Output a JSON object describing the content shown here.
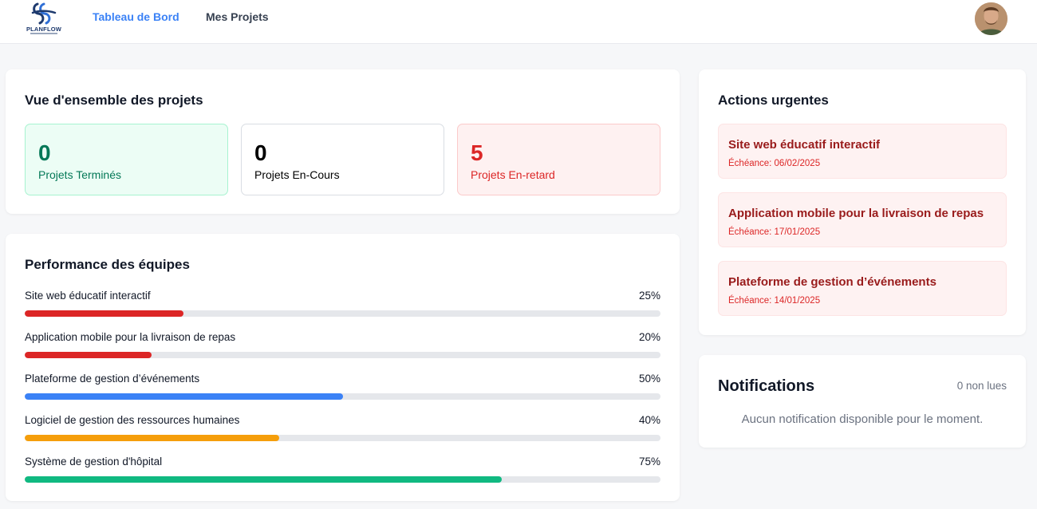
{
  "brand": {
    "name": "PLANFLOW",
    "accent_color": "#3b82f6"
  },
  "nav": {
    "links": [
      {
        "label": "Tableau de Bord",
        "active": true
      },
      {
        "label": "Mes Projets",
        "active": false
      }
    ],
    "avatar_icon": "user-avatar"
  },
  "overview": {
    "title": "Vue d'ensemble des projets",
    "stats": [
      {
        "value": "0",
        "label": "Projets Terminés",
        "color": "#047857"
      },
      {
        "value": "0",
        "label": "Projets En-Cours",
        "color": "#000000"
      },
      {
        "value": "5",
        "label": "Projets En-retard",
        "color": "#dc2626"
      }
    ]
  },
  "performance": {
    "title": "Performance des équipes",
    "items": [
      {
        "name": "Site web éducatif interactif",
        "percent_label": "25%",
        "value": 25,
        "color": "#dc2626"
      },
      {
        "name": "Application mobile pour la livraison de repas",
        "percent_label": "20%",
        "value": 20,
        "color": "#dc2626"
      },
      {
        "name": "Plateforme de gestion d’événements",
        "percent_label": "50%",
        "value": 50,
        "color": "#3b82f6"
      },
      {
        "name": "Logiciel de gestion des ressources humaines",
        "percent_label": "40%",
        "value": 40,
        "color": "#f59e0b"
      },
      {
        "name": "Système de gestion d'hôpital",
        "percent_label": "75%",
        "value": 75,
        "color": "#10b981"
      }
    ]
  },
  "urgent": {
    "title": "Actions urgentes",
    "items": [
      {
        "title": "Site web éducatif interactif",
        "due": "Échéance: 06/02/2025"
      },
      {
        "title": "Application mobile pour la livraison de repas",
        "due": "Échéance: 17/01/2025"
      },
      {
        "title": "Plateforme de gestion d’événements",
        "due": "Échéance: 14/01/2025"
      }
    ]
  },
  "notifications": {
    "title": "Notifications",
    "unread": "0 non lues",
    "empty_message": "Aucun notification disponible pour le moment."
  }
}
